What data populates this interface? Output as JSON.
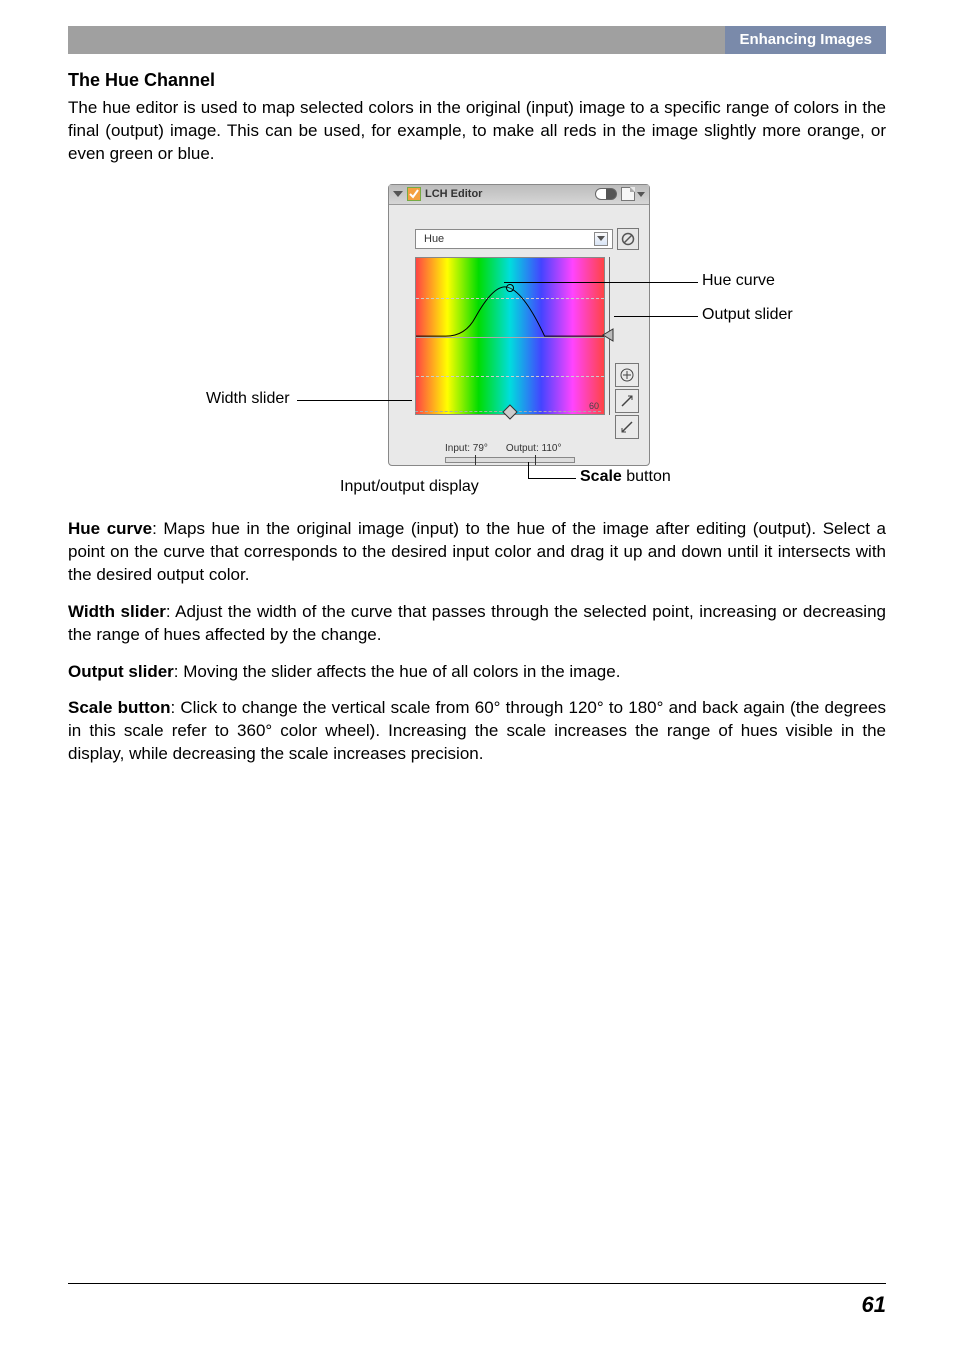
{
  "header": {
    "section": "Enhancing Images"
  },
  "heading": "The Hue Channel",
  "intro": "The hue editor is used to map selected colors in the original (input) image to a specific range of colors in the final (output) image.  This can be used, for example, to make all reds in the image slightly more orange, or even green or blue.",
  "panel": {
    "title": "LCH Editor",
    "dropdown_value": "Hue",
    "input_label": "Input: 79°",
    "output_label": "Output: 110°",
    "scale_text": "60"
  },
  "callouts": {
    "hue_curve": "Hue curve",
    "output_slider": "Output slider",
    "width_slider": "Width slider",
    "io_display": "Input/output display",
    "scale_button_prefix": "Scale",
    "scale_button_suffix": " button"
  },
  "defs": {
    "hue_curve": {
      "term": "Hue curve",
      "text": ": Maps hue in the original image (input) to the hue of the image after editing (output).  Select a point on the curve that corresponds to the desired input color and drag it up and down until it intersects with the desired output color."
    },
    "width_slider": {
      "term": "Width slider",
      "text": ": Adjust the width of the curve that passes through the selected point, increasing or decreasing the range of hues affected by the change."
    },
    "output_slider": {
      "term": "Output slider",
      "text": ": Moving the slider affects the hue of all colors in the image."
    },
    "scale_button": {
      "term": "Scale button",
      "text": ": Click to change the vertical scale from 60° through 120° to 180° and back again (the degrees in this scale refer to 360° color wheel).  Increasing the scale increases the range of hues visible in the display, while decreasing the scale increases precision."
    }
  },
  "page_number": "61"
}
